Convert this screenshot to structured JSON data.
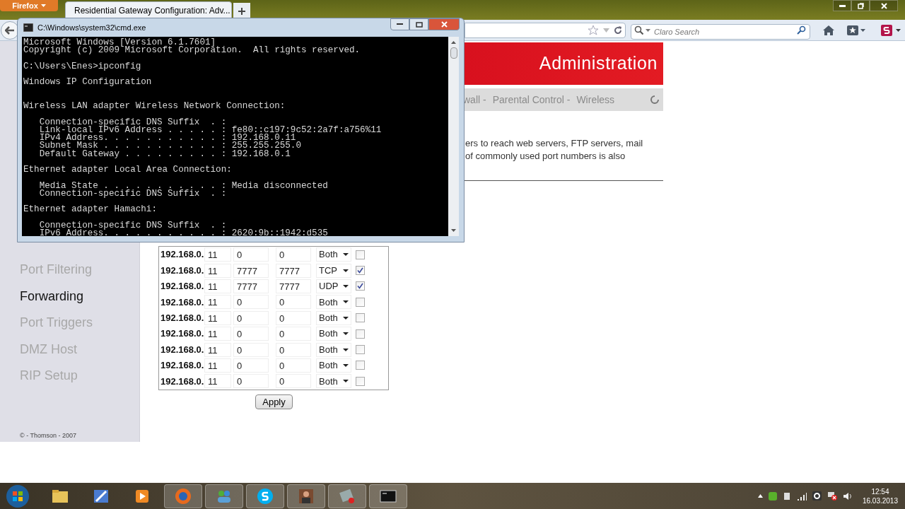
{
  "browser": {
    "menu_button": "Firefox",
    "tabs": [
      {
        "title": "Residential Gateway Configuration: Adv...",
        "selected": true
      }
    ],
    "search_placeholder": "Claro Search"
  },
  "page": {
    "header": "Administration",
    "nav": [
      "wall -",
      "Parental Control -",
      "Wireless"
    ],
    "intro_lines": [
      "ers to reach web servers, FTP servers, mail",
      "of commonly used port numbers is also"
    ],
    "sidebar": [
      {
        "label": "Port Filtering",
        "selected": false
      },
      {
        "label": "Forwarding",
        "selected": true
      },
      {
        "label": "Port Triggers",
        "selected": false
      },
      {
        "label": "DMZ Host",
        "selected": false
      },
      {
        "label": "RIP Setup",
        "selected": false
      }
    ],
    "forwarding_rows": [
      {
        "ip_prefix": "192.168.0.",
        "ip_suffix": "11",
        "start_port": "0",
        "end_port": "0",
        "protocol": "Both",
        "enabled": false
      },
      {
        "ip_prefix": "192.168.0.",
        "ip_suffix": "11",
        "start_port": "7777",
        "end_port": "7777",
        "protocol": "TCP",
        "enabled": true
      },
      {
        "ip_prefix": "192.168.0.",
        "ip_suffix": "11",
        "start_port": "7777",
        "end_port": "7777",
        "protocol": "UDP",
        "enabled": true
      },
      {
        "ip_prefix": "192.168.0.",
        "ip_suffix": "11",
        "start_port": "0",
        "end_port": "0",
        "protocol": "Both",
        "enabled": false
      },
      {
        "ip_prefix": "192.168.0.",
        "ip_suffix": "11",
        "start_port": "0",
        "end_port": "0",
        "protocol": "Both",
        "enabled": false
      },
      {
        "ip_prefix": "192.168.0.",
        "ip_suffix": "11",
        "start_port": "0",
        "end_port": "0",
        "protocol": "Both",
        "enabled": false
      },
      {
        "ip_prefix": "192.168.0.",
        "ip_suffix": "11",
        "start_port": "0",
        "end_port": "0",
        "protocol": "Both",
        "enabled": false
      },
      {
        "ip_prefix": "192.168.0.",
        "ip_suffix": "11",
        "start_port": "0",
        "end_port": "0",
        "protocol": "Both",
        "enabled": false
      },
      {
        "ip_prefix": "192.168.0.",
        "ip_suffix": "11",
        "start_port": "0",
        "end_port": "0",
        "protocol": "Both",
        "enabled": false
      }
    ],
    "apply_button": "Apply",
    "footer": "© - Thomson - 2007"
  },
  "console": {
    "title": "C:\\Windows\\system32\\cmd.exe",
    "header_lines": [
      "Microsoft Windows [Version 6.1.7601]",
      "Copyright (c) 2009 Microsoft Corporation.  All rights reserved."
    ],
    "prompt": "C:\\Users\\Enes>ipconfig",
    "heading": "Windows IP Configuration",
    "adapters": [
      {
        "title": "Wireless LAN adapter Wireless Network Connection:",
        "entries": [
          {
            "label": "Connection-specific DNS Suffix  . :"
          },
          {
            "label": "Link-local IPv6 Address . . . . . :",
            "value": "fe80::c197:9c52:2a7f:a756%11"
          },
          {
            "label": "IPv4 Address. . . . . . . . . . . :",
            "value": "192.168.0.11"
          },
          {
            "label": "Subnet Mask . . . . . . . . . . . :",
            "value": "255.255.255.0"
          },
          {
            "label": "Default Gateway . . . . . . . . . :",
            "value": "192.168.0.1"
          }
        ]
      },
      {
        "title": "Ethernet adapter Local Area Connection:",
        "entries": [
          {
            "label": "Media State . . . . . . . . . . . :",
            "value": "Media disconnected"
          },
          {
            "label": "Connection-specific DNS Suffix  . :"
          }
        ]
      },
      {
        "title": "Ethernet adapter Hamachi:",
        "entries": [
          {
            "label": "Connection-specific DNS Suffix  . :"
          },
          {
            "label": "IPv6 Address. . . . . . . . . . . :",
            "value": "2620:9b::1942:d535"
          }
        ]
      }
    ]
  },
  "taskbar": {
    "items": [
      {
        "kind": "folder",
        "running": false
      },
      {
        "kind": "pen",
        "running": false
      },
      {
        "kind": "media",
        "running": false
      },
      {
        "kind": "browser",
        "running": true
      },
      {
        "kind": "people",
        "running": true
      },
      {
        "kind": "skype",
        "running": true
      },
      {
        "kind": "figure",
        "running": true
      },
      {
        "kind": "tool",
        "running": true
      },
      {
        "kind": "console",
        "running": true
      }
    ],
    "time": "12:54",
    "date": "16.03.2013"
  }
}
